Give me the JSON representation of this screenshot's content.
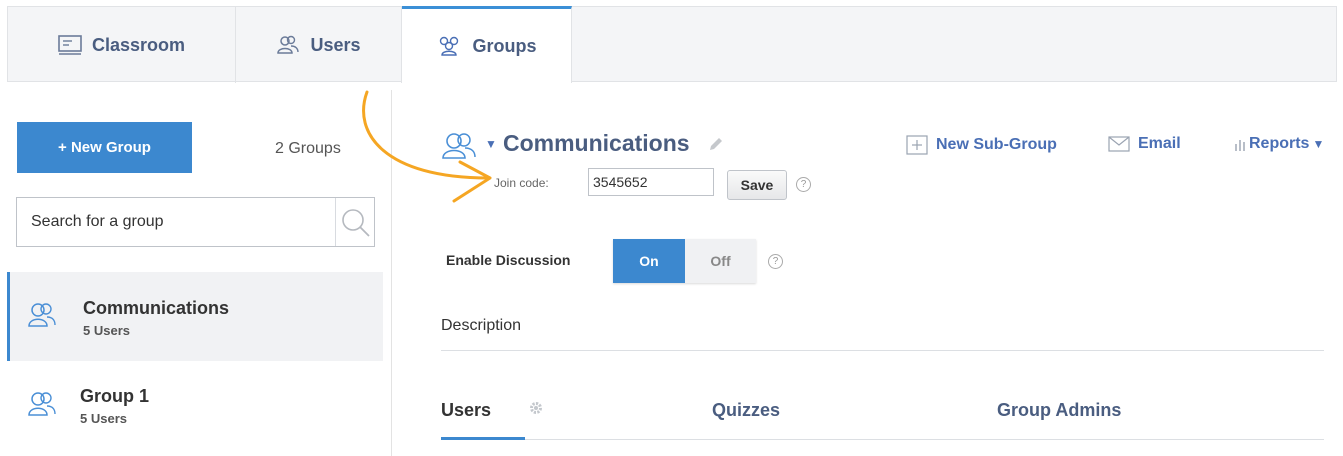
{
  "tabs": {
    "classroom": "Classroom",
    "users": "Users",
    "groups": "Groups"
  },
  "sidebar": {
    "new_group_label": "+ New Group",
    "group_count": "2 Groups",
    "search_placeholder": "Search for a group",
    "groups": [
      {
        "name": "Communications",
        "subtitle": "5 Users",
        "active": true
      },
      {
        "name": "Group 1",
        "subtitle": "5 Users",
        "active": false
      }
    ]
  },
  "main": {
    "title": "Communications",
    "actions": {
      "new_subgroup": "New Sub-Group",
      "email": "Email",
      "reports": "Reports"
    },
    "join_code_label": "Join code:",
    "join_code_value": "3545652",
    "save_label": "Save",
    "help_glyph": "?",
    "enable_discussion_label": "Enable Discussion",
    "toggle_on": "On",
    "toggle_off": "Off",
    "toggle_state": "On",
    "description_label": "Description",
    "sub_tabs": [
      "Users",
      "Quizzes",
      "Group Admins"
    ],
    "active_sub_tab": "Users"
  },
  "colors": {
    "accent": "#3c88cf",
    "title_text": "#4a5d80",
    "link_text": "#4a6fb5",
    "annotation_arrow": "#f5a623"
  },
  "icons": [
    "classroom-icon",
    "users-icon",
    "groups-icon",
    "search-icon",
    "group-icon",
    "caret-down-icon",
    "pencil-icon",
    "new-subgroup-icon",
    "email-icon",
    "reports-icon",
    "help-icon",
    "gear-icon",
    "annotation-arrow"
  ]
}
